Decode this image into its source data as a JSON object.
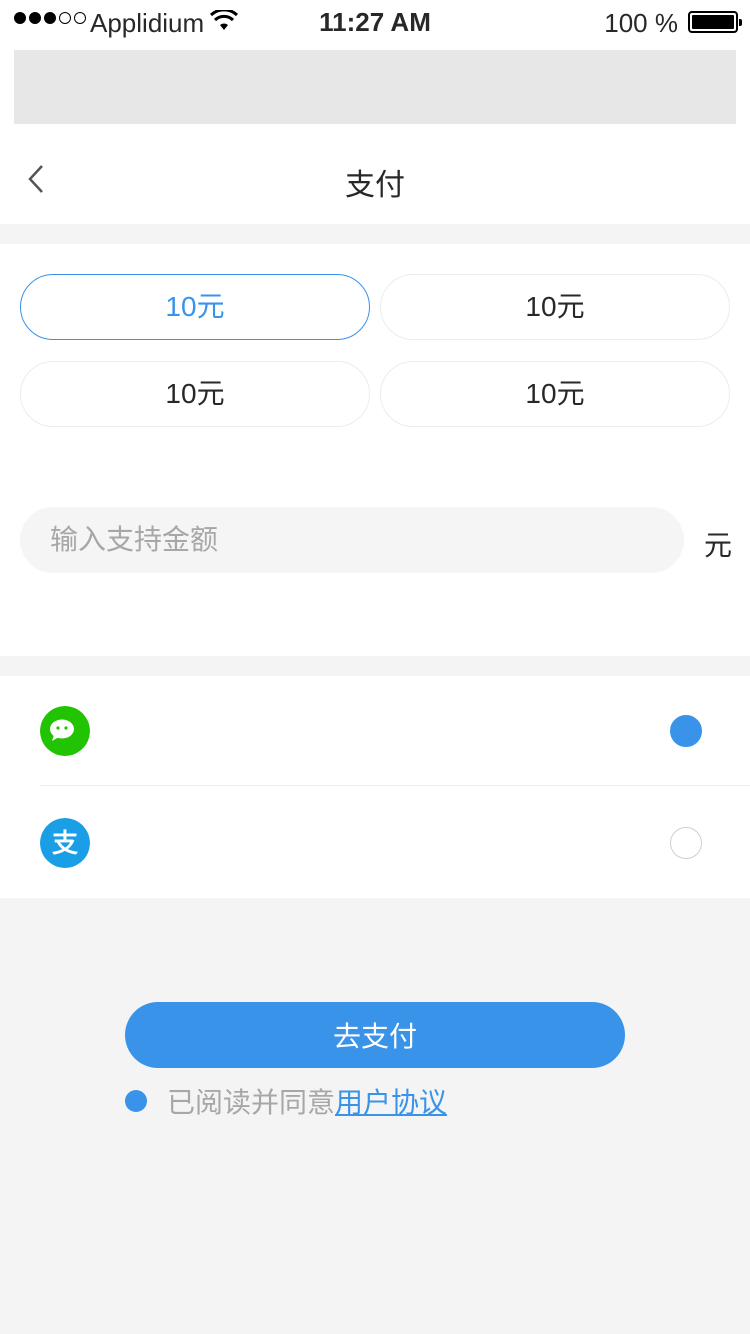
{
  "status_bar": {
    "carrier": "Applidium",
    "time": "11:27 AM",
    "battery": "100 %"
  },
  "nav": {
    "title": "支付",
    "back_icon": "chevron-left-icon"
  },
  "amount_options": [
    {
      "label": "10元",
      "selected": true
    },
    {
      "label": "10元",
      "selected": false
    },
    {
      "label": "10元",
      "selected": false
    },
    {
      "label": "10元",
      "selected": false
    }
  ],
  "custom_amount": {
    "placeholder": "输入支持金额",
    "unit": "元"
  },
  "payment_methods": [
    {
      "icon": "wechat-pay-icon",
      "icon_color": "#21c302",
      "selected": true
    },
    {
      "icon": "alipay-icon",
      "icon_color": "#1a9fe6",
      "selected": false
    }
  ],
  "submit": {
    "label": "去支付"
  },
  "agreement": {
    "text": "已阅读并同意",
    "link": "用户协议",
    "checked": true
  },
  "colors": {
    "accent": "#3993e9",
    "border": "#ececec",
    "input_bg": "#f5f5f5",
    "text": "#282828",
    "muted": "#a7a7a7"
  }
}
